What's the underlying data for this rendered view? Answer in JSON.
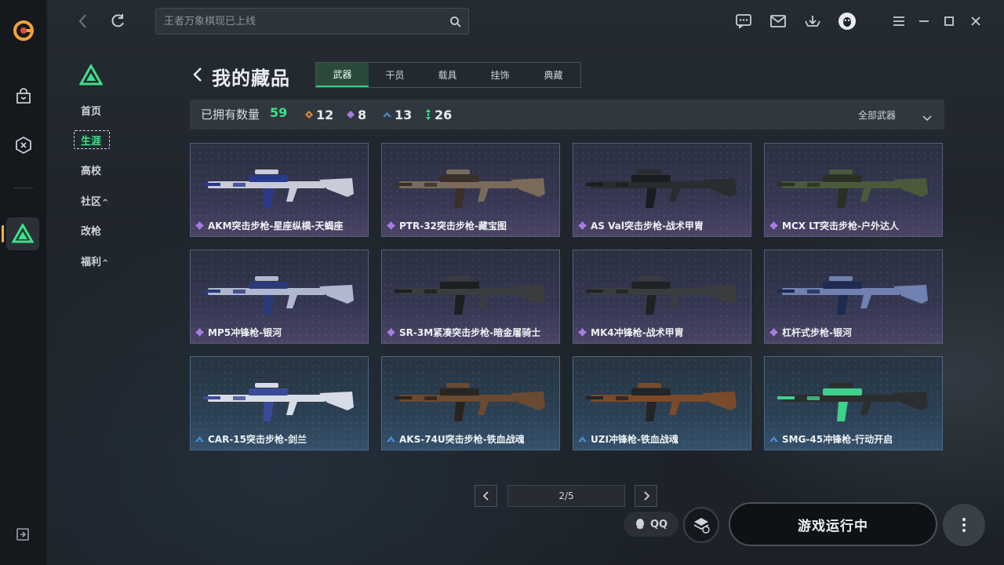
{
  "search": {
    "placeholder": "王者万象棋现已上线"
  },
  "sidenav": {
    "items": [
      {
        "label": "首页",
        "active": false
      },
      {
        "label": "生涯",
        "active": true
      },
      {
        "label": "高校",
        "active": false
      },
      {
        "label": "社区",
        "active": false,
        "has_submenu": true
      },
      {
        "label": "改枪",
        "active": false
      },
      {
        "label": "福利",
        "active": false,
        "has_submenu": true
      }
    ],
    "submenu_caret": "^"
  },
  "page": {
    "title": "我的藏品"
  },
  "tabs": [
    {
      "label": "武器",
      "active": true
    },
    {
      "label": "干员",
      "active": false
    },
    {
      "label": "载具",
      "active": false
    },
    {
      "label": "挂饰",
      "active": false
    },
    {
      "label": "典藏",
      "active": false
    }
  ],
  "stats": {
    "owned_label": "已拥有数量",
    "owned_total": "59",
    "rarities": [
      {
        "icon": "orange-diamond-icon",
        "color": "#e08a3c",
        "count": "12"
      },
      {
        "icon": "purple-diamond-icon",
        "color": "#a77be0",
        "count": "8"
      },
      {
        "icon": "blue-chevron-icon",
        "color": "#4a90d9",
        "count": "13"
      },
      {
        "icon": "green-arrows-icon",
        "color": "#3fe08a",
        "count": "26"
      }
    ],
    "filter_label": "全部武器"
  },
  "items": [
    {
      "name": "AKM突击步枪-星座纵横-天蝎座",
      "rarity": "purple"
    },
    {
      "name": "PTR-32突击步枪-藏宝图",
      "rarity": "purple"
    },
    {
      "name": "AS Val突击步枪-战术甲胄",
      "rarity": "purple"
    },
    {
      "name": "MCX LT突击步枪-户外达人",
      "rarity": "purple"
    },
    {
      "name": "MP5冲锋枪-银河",
      "rarity": "purple"
    },
    {
      "name": "SR-3M紧凑突击步枪-暗金屠骑士",
      "rarity": "purple"
    },
    {
      "name": "MK4冲锋枪-战术甲胄",
      "rarity": "purple"
    },
    {
      "name": "杠杆式步枪-银河",
      "rarity": "purple"
    },
    {
      "name": "CAR-15突击步枪-剑兰",
      "rarity": "blue"
    },
    {
      "name": "AKS-74U突击步枪-铁血战魂",
      "rarity": "blue"
    },
    {
      "name": "UZI冲锋枪-铁血战魂",
      "rarity": "blue"
    },
    {
      "name": "SMG-45冲锋枪-行动开启",
      "rarity": "blue"
    }
  ],
  "pagination": {
    "text": "2/5"
  },
  "footer": {
    "qq_label": "QQ",
    "launch_label": "游戏运行中"
  },
  "colors": {
    "accent": "#3fe08a",
    "purple": "#a77be0",
    "blue": "#4a90d9"
  }
}
